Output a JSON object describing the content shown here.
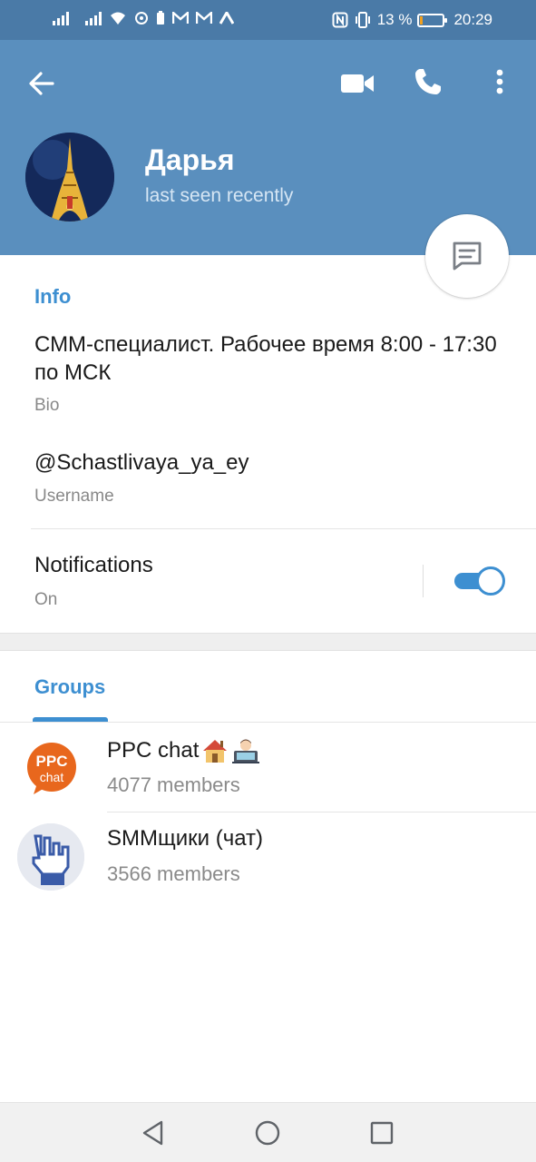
{
  "status_bar": {
    "battery_percent": "13 %",
    "battery_level": 0.13,
    "time": "20:29",
    "left_icons": [
      "signal-icon",
      "signal-icon",
      "wifi-icon",
      "sync-icon",
      "battery-saver-icon",
      "gmail-icon",
      "gmail-icon",
      "app-icon"
    ],
    "right_icons": [
      "nfc-icon",
      "vibrate-icon"
    ]
  },
  "header": {
    "name": "Дарья",
    "status": "last seen recently",
    "actions": [
      "back-arrow-icon",
      "video-call-icon",
      "phone-icon",
      "more-vertical-icon"
    ]
  },
  "info": {
    "title": "Info",
    "bio": "СММ-специалист. Рабочее время 8:00 - 17:30 по МСК",
    "bio_label": "Bio",
    "username": "@Schastlivaya_ya_ey",
    "username_label": "Username",
    "notifications_label": "Notifications",
    "notifications_state": "On",
    "notifications_enabled": true
  },
  "tabs": {
    "groups_label": "Groups"
  },
  "groups": [
    {
      "name": "PPC chat",
      "members": "4077 members",
      "avatar_text_top": "PPC",
      "avatar_text_bottom": "chat",
      "emojis": [
        "house-emoji",
        "technologist-emoji"
      ]
    },
    {
      "name": "SMMщики (чат)",
      "members": "3566 members",
      "avatar": "hand-icon"
    }
  ],
  "colors": {
    "header_bg": "#5a8fbe",
    "status_bar_bg": "#4a7aa7",
    "accent": "#3d8fd1",
    "ppc_orange": "#e8671d"
  }
}
